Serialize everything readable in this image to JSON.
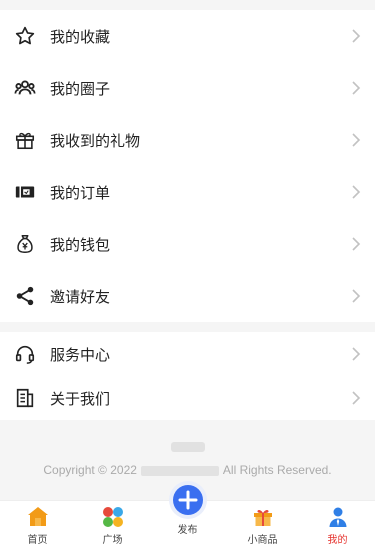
{
  "menu_primary": [
    {
      "name": "favorites",
      "label": "我的收藏",
      "icon": "star-icon"
    },
    {
      "name": "circles",
      "label": "我的圈子",
      "icon": "group-icon"
    },
    {
      "name": "gifts",
      "label": "我收到的礼物",
      "icon": "gift-icon"
    },
    {
      "name": "orders",
      "label": "我的订单",
      "icon": "ticket-icon"
    },
    {
      "name": "wallet",
      "label": "我的钱包",
      "icon": "money-bag-icon"
    },
    {
      "name": "invite",
      "label": "邀请好友",
      "icon": "share-icon"
    }
  ],
  "menu_secondary": [
    {
      "name": "service",
      "label": "服务中心",
      "icon": "headset-icon"
    },
    {
      "name": "about",
      "label": "关于我们",
      "icon": "document-icon"
    }
  ],
  "footer": {
    "copyright_prefix": "Copyright © 2022",
    "copyright_suffix": "All Rights Reserved."
  },
  "tabbar": [
    {
      "name": "home",
      "label": "首页",
      "icon": "home-icon"
    },
    {
      "name": "plaza",
      "label": "广场",
      "icon": "plaza-icon"
    },
    {
      "name": "publish",
      "label": "发布",
      "icon": "plus-circle-icon"
    },
    {
      "name": "mall",
      "label": "小商品",
      "icon": "gift-box-icon"
    },
    {
      "name": "mine",
      "label": "我的",
      "icon": "user-icon",
      "active": true
    }
  ],
  "colors": {
    "active_tab": "#e5322d",
    "publish_button": "#3a6ff0",
    "chevron": "#c2c2c2"
  }
}
